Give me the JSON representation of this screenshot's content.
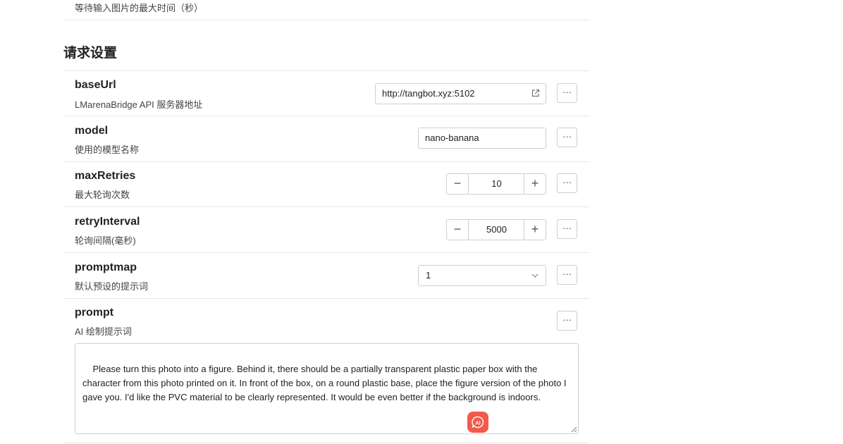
{
  "top_item": {
    "desc": "等待输入图片的最大时间（秒）"
  },
  "section": {
    "title": "请求设置"
  },
  "settings": {
    "baseUrl": {
      "name": "baseUrl",
      "desc": "LMarenaBridge API 服务器地址",
      "value": "http://tangbot.xyz:5102"
    },
    "model": {
      "name": "model",
      "desc": "使用的模型名称",
      "value": "nano-banana"
    },
    "maxRetries": {
      "name": "maxRetries",
      "desc": "最大轮询次数",
      "value": "10",
      "minus": "−",
      "plus": "+"
    },
    "retryInterval": {
      "name": "retryInterval",
      "desc": "轮询间隔(毫秒)",
      "value": "5000",
      "minus": "−",
      "plus": "+"
    },
    "promptmap": {
      "name": "promptmap",
      "desc": "默认预设的提示词",
      "value": "1"
    },
    "prompt": {
      "name": "prompt",
      "desc": "AI 绘制提示词",
      "value": "Please turn this photo into a figure. Behind it, there should be a partially transparent plastic paper box with the character from this photo printed on it. In front of the box, on a round plastic base, place the figure version of the photo I gave you. I'd like the PVC material to be clearly represented. It would be even better if the background is indoors."
    }
  },
  "more_label": "···",
  "icons": {
    "external_link": "external-link-icon",
    "chevron": "chevron-down-icon",
    "ai": "ai-assistant-icon",
    "resize": "resize-handle-icon"
  },
  "colors": {
    "accent": "#f25a4a",
    "border": "#cfcfcf",
    "divider": "#e6e6e6"
  }
}
